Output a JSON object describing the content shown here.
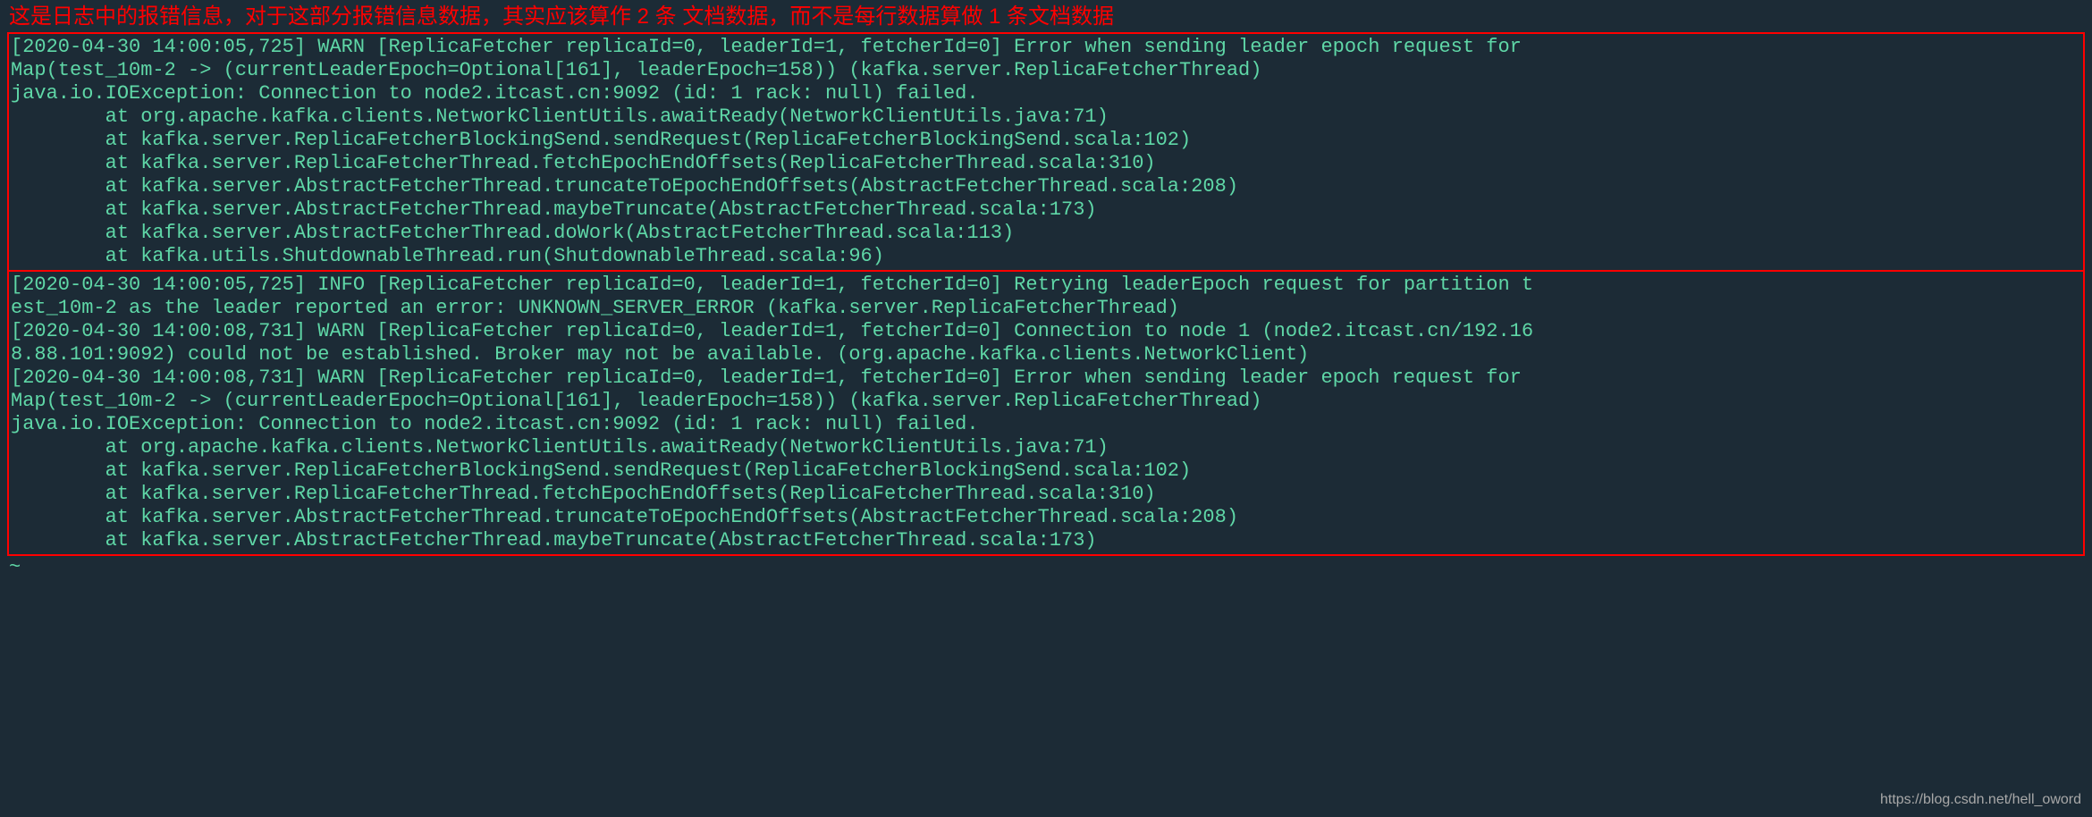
{
  "caption": "这是日志中的报错信息，对于这部分报错信息数据，其实应该算作 2 条 文档数据，而不是每行数据算做 1 条文档数据",
  "log1": "[2020-04-30 14:00:05,725] WARN [ReplicaFetcher replicaId=0, leaderId=1, fetcherId=0] Error when sending leader epoch request for\nMap(test_10m-2 -> (currentLeaderEpoch=Optional[161], leaderEpoch=158)) (kafka.server.ReplicaFetcherThread)\njava.io.IOException: Connection to node2.itcast.cn:9092 (id: 1 rack: null) failed.\n        at org.apache.kafka.clients.NetworkClientUtils.awaitReady(NetworkClientUtils.java:71)\n        at kafka.server.ReplicaFetcherBlockingSend.sendRequest(ReplicaFetcherBlockingSend.scala:102)\n        at kafka.server.ReplicaFetcherThread.fetchEpochEndOffsets(ReplicaFetcherThread.scala:310)\n        at kafka.server.AbstractFetcherThread.truncateToEpochEndOffsets(AbstractFetcherThread.scala:208)\n        at kafka.server.AbstractFetcherThread.maybeTruncate(AbstractFetcherThread.scala:173)\n        at kafka.server.AbstractFetcherThread.doWork(AbstractFetcherThread.scala:113)\n        at kafka.utils.ShutdownableThread.run(ShutdownableThread.scala:96)",
  "log2": "[2020-04-30 14:00:05,725] INFO [ReplicaFetcher replicaId=0, leaderId=1, fetcherId=0] Retrying leaderEpoch request for partition t\nest_10m-2 as the leader reported an error: UNKNOWN_SERVER_ERROR (kafka.server.ReplicaFetcherThread)\n[2020-04-30 14:00:08,731] WARN [ReplicaFetcher replicaId=0, leaderId=1, fetcherId=0] Connection to node 1 (node2.itcast.cn/192.16\n8.88.101:9092) could not be established. Broker may not be available. (org.apache.kafka.clients.NetworkClient)\n[2020-04-30 14:00:08,731] WARN [ReplicaFetcher replicaId=0, leaderId=1, fetcherId=0] Error when sending leader epoch request for\nMap(test_10m-2 -> (currentLeaderEpoch=Optional[161], leaderEpoch=158)) (kafka.server.ReplicaFetcherThread)\njava.io.IOException: Connection to node2.itcast.cn:9092 (id: 1 rack: null) failed.\n        at org.apache.kafka.clients.NetworkClientUtils.awaitReady(NetworkClientUtils.java:71)\n        at kafka.server.ReplicaFetcherBlockingSend.sendRequest(ReplicaFetcherBlockingSend.scala:102)\n        at kafka.server.ReplicaFetcherThread.fetchEpochEndOffsets(ReplicaFetcherThread.scala:310)\n        at kafka.server.AbstractFetcherThread.truncateToEpochEndOffsets(AbstractFetcherThread.scala:208)\n        at kafka.server.AbstractFetcherThread.maybeTruncate(AbstractFetcherThread.scala:173)",
  "tilde": "~",
  "watermark": "https://blog.csdn.net/hell_oword"
}
